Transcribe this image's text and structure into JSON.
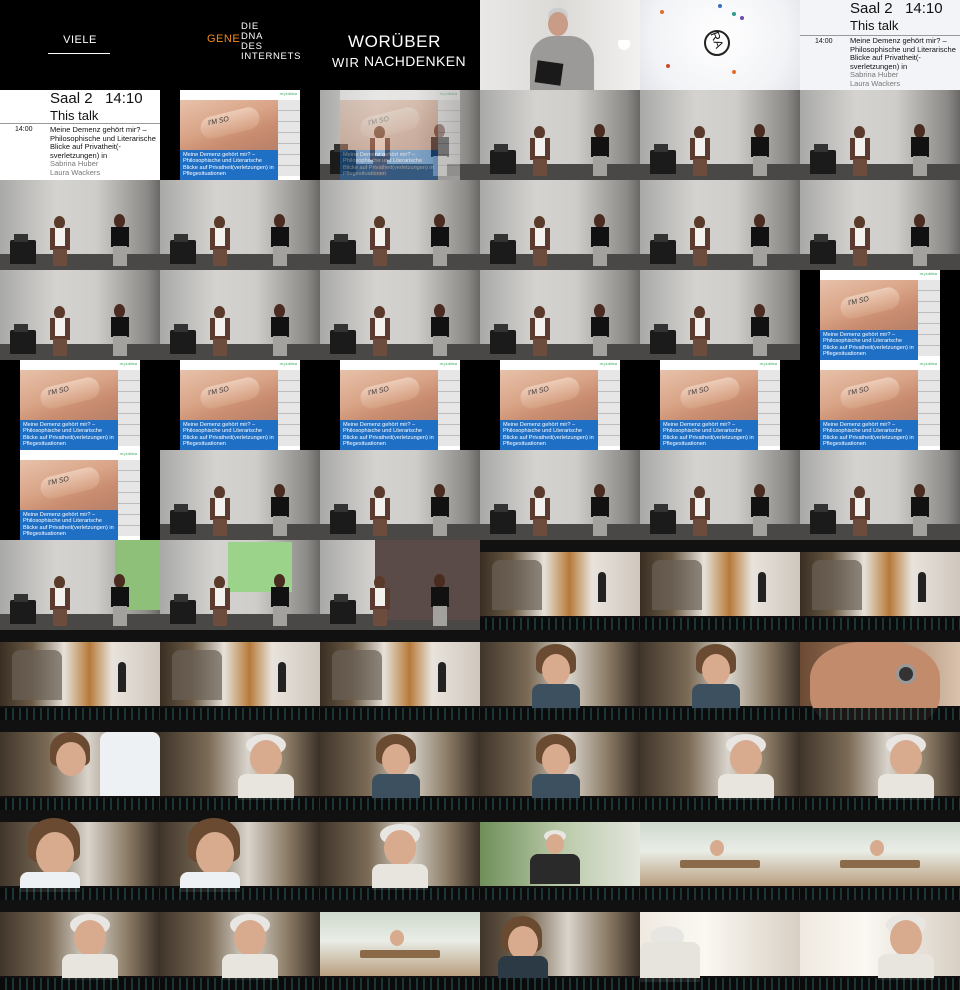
{
  "title_cards": {
    "viele": "VIELE",
    "gene": "GENE",
    "dna_lines": [
      "DIE",
      "DNA",
      "DES",
      "INTERNETS"
    ],
    "woruber": "WORÜBER",
    "wir": "WIR",
    "nachdenken": "NACHDENKEN",
    "ra_logo": "RA"
  },
  "schedule": {
    "room": "Saal 2",
    "start": "14:10",
    "this_talk": "This talk",
    "time": "14:00",
    "talk_title": "Meine Demenz gehört mir? – Philosophische und Literarische Blicke auf Privatheit(-sverletzungen) in",
    "speakers": [
      "Sabrina Huber",
      "Laura Wackers"
    ]
  },
  "slide": {
    "caption": "Meine Demenz gehört mir? – Philosophische und Literarische Blicke auf Privatheit(verletzungen) in Pflegesituationen",
    "hand_text": "I'M SO",
    "logo": "re:publica"
  },
  "colors": {
    "gene_orange": "#f28a1e",
    "slide_blue": "#1f6fc4",
    "green_screen": "#8ec07a"
  },
  "cells": [
    "viele",
    "gene",
    "woruber",
    "man",
    "ra",
    "sched",
    "sched2",
    "slide-raw",
    "slide-fade",
    "talk",
    "talk",
    "talk",
    "talk",
    "talk",
    "talk",
    "talk",
    "talk",
    "talk",
    "talk",
    "talk",
    "talk",
    "talk",
    "talk",
    "slide",
    "slide",
    "slide",
    "slide",
    "slide",
    "slide",
    "slide",
    "slide",
    "talk",
    "talk",
    "talk",
    "talk",
    "talk",
    "talk-green",
    "talk-green2",
    "talk-dark",
    "film-hall",
    "film-hall",
    "film-hall",
    "film-hall",
    "film-hall",
    "film-hall",
    "film-girl",
    "film-girl",
    "film-steth",
    "film-girl-doc",
    "film-old",
    "film-girl",
    "film-girl",
    "film-old",
    "film-old",
    "film-girl-close",
    "film-girl-close",
    "film-old-side",
    "film-old-green",
    "film-cafe",
    "film-cafe",
    "film-old-laugh",
    "film-old-laugh",
    "film-cafe-lunch",
    "film-girl-dark",
    "film-old-back",
    "film-old-think"
  ]
}
